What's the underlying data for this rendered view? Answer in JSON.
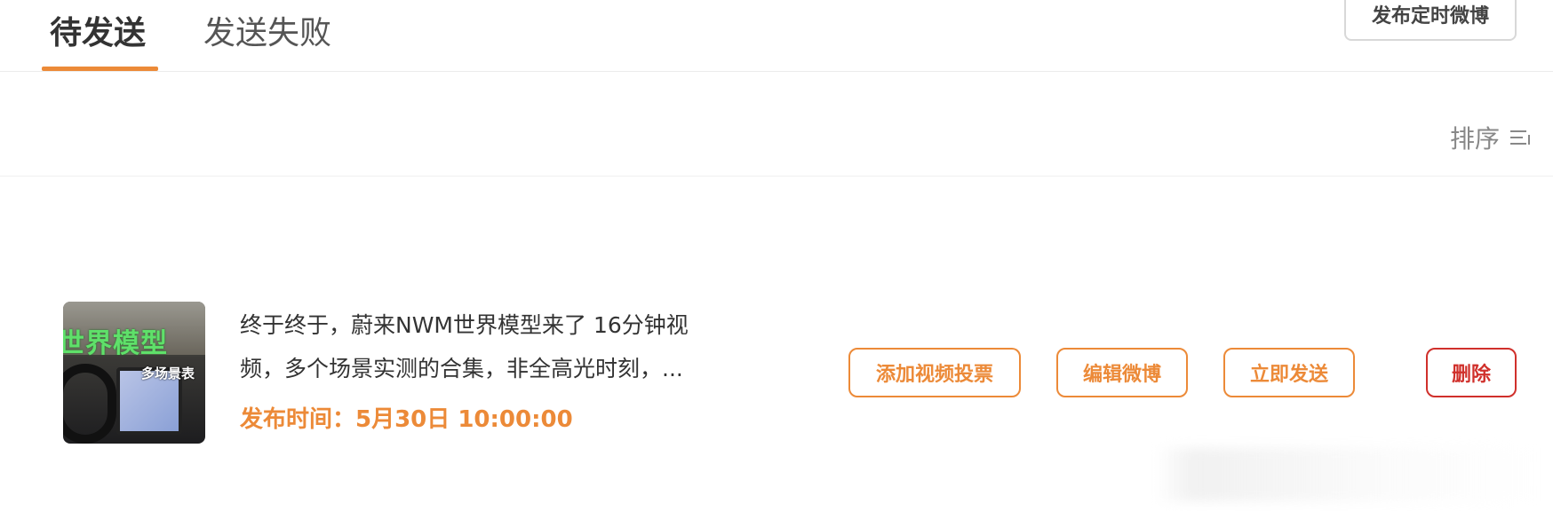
{
  "tabs": [
    {
      "label": "待发送",
      "active": true
    },
    {
      "label": "发送失败",
      "active": false
    }
  ],
  "header": {
    "publish_button": "发布定时微博"
  },
  "sort": {
    "label": "排序",
    "icon": "sort-icon"
  },
  "item": {
    "thumbnail": {
      "title_text": "世界模型",
      "subtitle_text": "多场景表"
    },
    "description": "终于终于，蔚来NWM世界模型来了 16分钟视频，多个场景实测的合集，非全高光时刻，...",
    "publish_time": "发布时间：5月30日 10:00:00",
    "buttons": {
      "add_vote": "添加视频投票",
      "edit": "编辑微博",
      "send_now": "立即发送",
      "delete": "删除"
    }
  },
  "colors": {
    "accent": "#ec8a38",
    "danger": "#d0302b"
  }
}
